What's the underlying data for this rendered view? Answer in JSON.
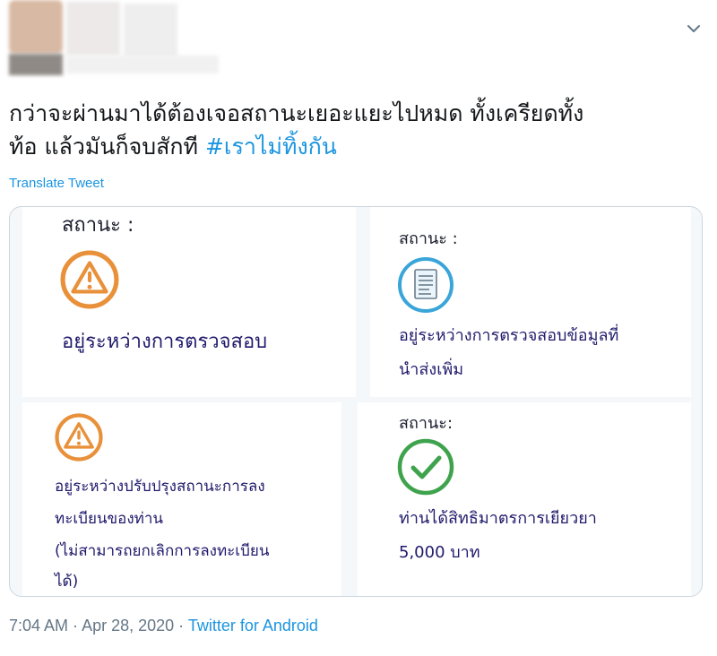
{
  "tweet": {
    "text_line1": "กว่าจะผ่านมาได้ต้องเจอสถานะเยอะแยะไปหมด ทั้งเครียดทั้ง",
    "text_line2": "ท้อ แล้วมันก็จบสักที ",
    "hashtag": "#เราไม่ทิ้งกัน",
    "translate_label": "Translate Tweet",
    "time": "7:04 AM",
    "separator": " · ",
    "date": "Apr 28, 2020",
    "source": "Twitter for Android"
  },
  "panels": {
    "top_left": {
      "label": "สถานะ :",
      "icon": "warning-icon",
      "status": "อยู่ระหว่างการตรวจสอบ"
    },
    "top_right": {
      "label": "สถานะ :",
      "icon": "document-icon",
      "status_line1": "อยู่ระหว่างการตรวจสอบข้อมูลที่",
      "status_line2": "นำส่งเพิ่ม"
    },
    "bottom_left": {
      "icon": "warning-icon",
      "status_line1": "อยู่ระหว่างปรับปรุงสถานะการลง",
      "status_line2": "ทะเบียนของท่าน",
      "status_line3": "(ไม่สามารถยกเลิกการลงทะเบียน",
      "status_line4": "ได้)"
    },
    "bottom_right": {
      "label": "สถานะ:",
      "icon": "check-circle-icon",
      "status_line1": "ท่านได้สิทธิมาตรการเยียวยา",
      "status_line2": "5,000 บาท"
    }
  },
  "colors": {
    "warning": "#e8913a",
    "document": "#3aa5d8",
    "check": "#3fa34d",
    "status_text": "#1f1a6b",
    "link": "#1b95e0"
  }
}
